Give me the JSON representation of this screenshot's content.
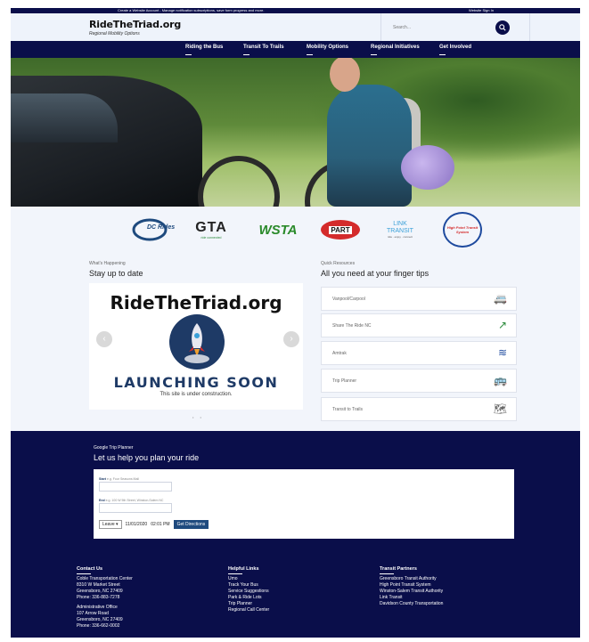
{
  "topbar": {
    "message": "Create a Website Account - Manage notification subscriptions, save form progress and more.",
    "signin": "Website Sign In"
  },
  "header": {
    "logo_title": "RideTheTriad.org",
    "logo_tagline": "Regional Mobility Options",
    "search_placeholder": "Search...",
    "search_icon": "search-icon"
  },
  "nav": {
    "items": [
      "Riding the Bus",
      "Transit To Trails",
      "Mobility Options",
      "Regional Initiatives",
      "Get Involved"
    ]
  },
  "partners": {
    "logos": [
      "DC Rides",
      "GTA",
      "ride connected",
      "WSTA",
      "PART",
      "LINK TRANSIT",
      "ride · enjoy · connect",
      "High Point Transit System"
    ]
  },
  "news": {
    "label": "What's Happening",
    "title": "Stay up to date",
    "slide_brand": "RideTheTriad.org",
    "slide_heading": "LAUNCHING SOON",
    "slide_sub": "This site is under construction.",
    "prev": "‹",
    "next": "›",
    "dots": "• •"
  },
  "resources": {
    "label": "Quick Resources",
    "title": "All you need at your finger tips",
    "items": [
      {
        "label": "Vanpool/Carpool",
        "icon": "van-icon",
        "glyph": "🚐"
      },
      {
        "label": "Share The Ride NC",
        "icon": "share-the-ride-logo",
        "glyph": "↗"
      },
      {
        "label": "Amtrak",
        "icon": "amtrak-logo",
        "glyph": "≋"
      },
      {
        "label": "Trip Planner",
        "icon": "bus-icon",
        "glyph": "🚌"
      },
      {
        "label": "Transit to Trails",
        "icon": "map-icon",
        "glyph": "🗺"
      }
    ]
  },
  "planner": {
    "label": "Google Trip Planner",
    "title": "Let us help you plan your ride",
    "start_label": "Start",
    "start_hint": "e.g. Four Seasons Mall",
    "end_label": "End",
    "end_hint": "e.g. 100 W 5th Street, Winston-Salem NC",
    "mode": "Leave",
    "date": "11/01/2020",
    "time": "02:01 PM",
    "button": "Get Directions"
  },
  "footer": {
    "contact": {
      "title": "Contact Us",
      "lines": [
        "Coble Transportation Center",
        "8310 W Market Street",
        "Greensboro, NC 27409",
        "Phone: 336-883-7278"
      ],
      "lines2": [
        "Administrative Office",
        "107 Arrow Road",
        "Greensboro, NC 27409",
        "Phone: 336-662-0002"
      ]
    },
    "helpful": {
      "title": "Helpful Links",
      "lines": [
        "Umo",
        "Track Your Bus",
        "Service Suggestions",
        "Park & Ride Lots",
        "Trip Planner",
        "Regional Call Center"
      ]
    },
    "partners": {
      "title": "Transit Partners",
      "lines": [
        "Greensboro Transit Authority",
        "High Point Transit System",
        "Winston-Salem Transit Authority",
        "Link Transit",
        "Davidson County Transportation"
      ]
    }
  },
  "colors": {
    "navy": "#0a0e4a",
    "light_bg": "#f2f5fb",
    "accent_blue": "#1e3a66"
  }
}
